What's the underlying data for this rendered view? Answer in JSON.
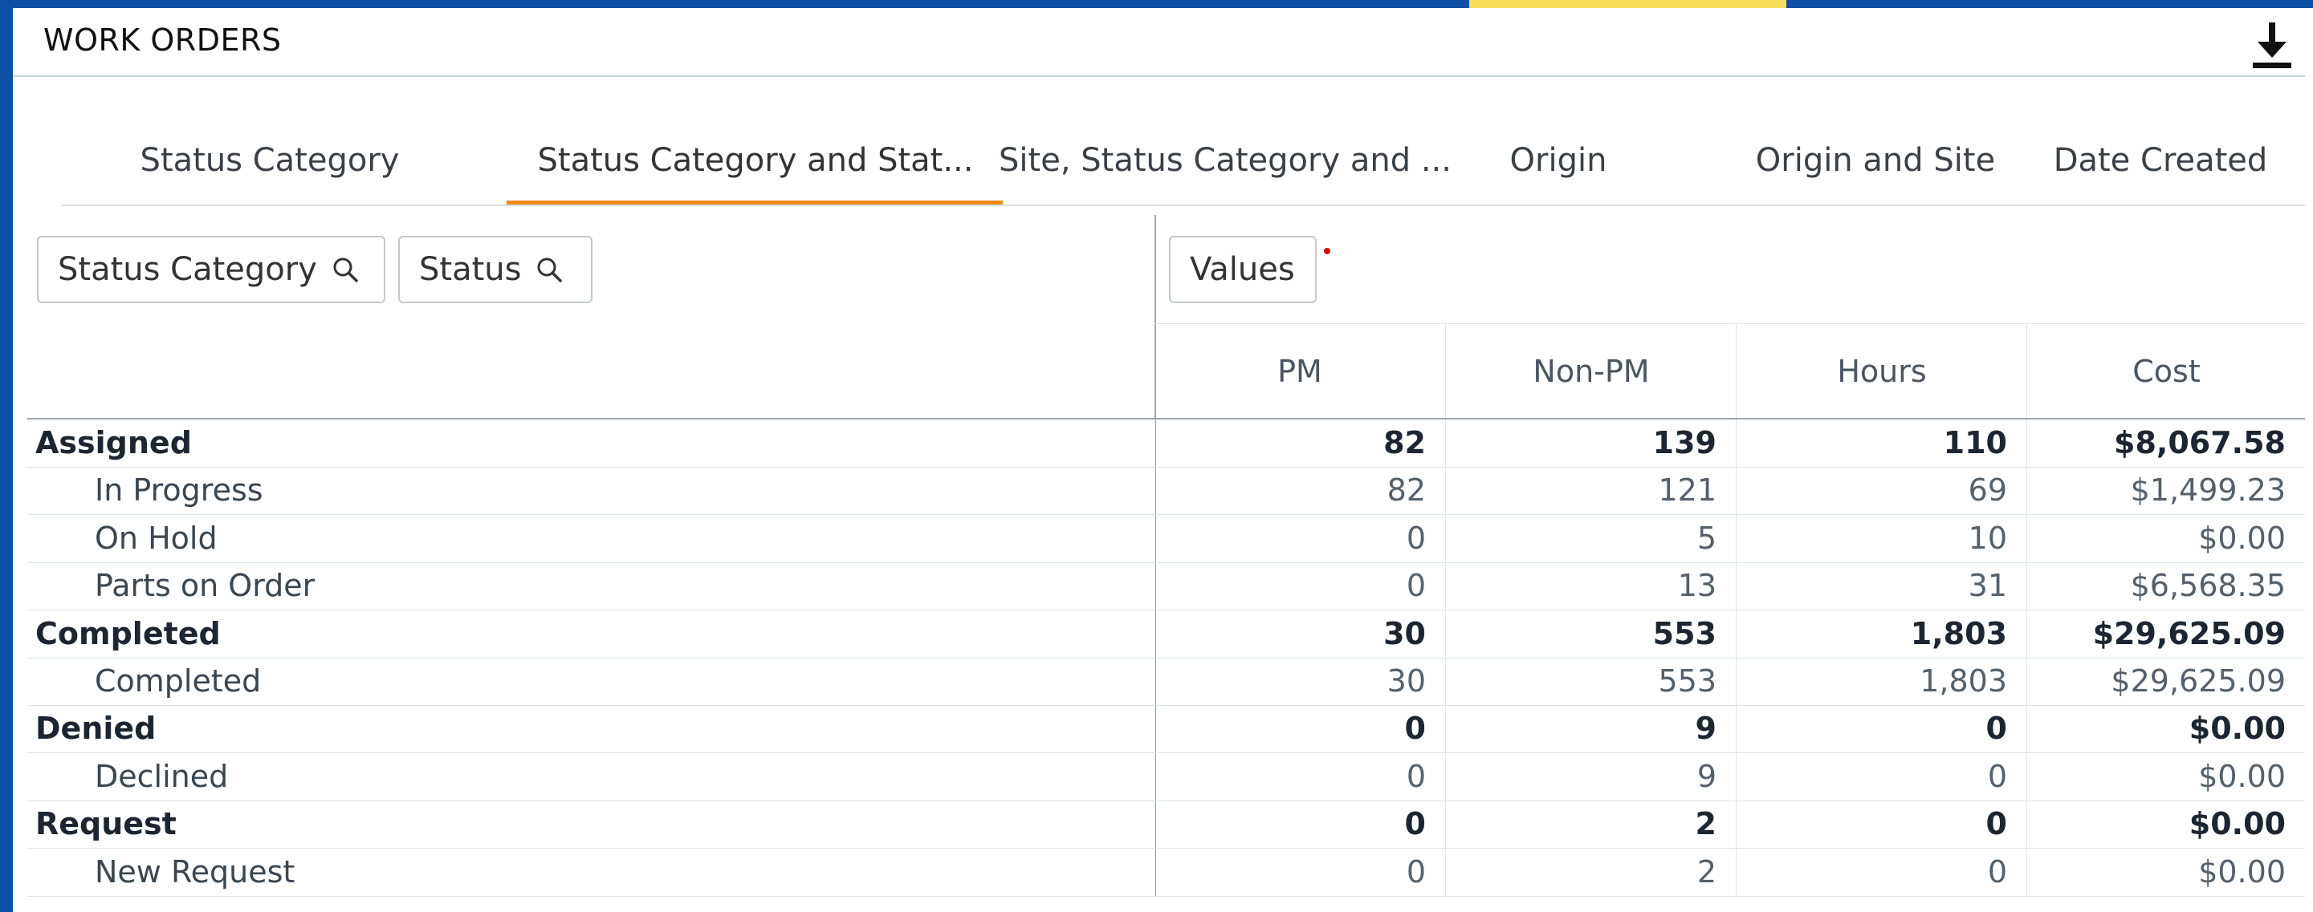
{
  "panel": {
    "title": "WORK ORDERS",
    "download_icon": "download-icon"
  },
  "tabs": [
    {
      "label": "Status Category"
    },
    {
      "label": "Status Category and Stat..."
    },
    {
      "label": "Site, Status Category and ..."
    },
    {
      "label": "Origin"
    },
    {
      "label": "Origin and Site"
    },
    {
      "label": "Date Created"
    }
  ],
  "active_tab": 1,
  "filters": {
    "status_category": "Status Category",
    "status": "Status",
    "values": "Values"
  },
  "columns": [
    "PM",
    "Non-PM",
    "Hours",
    "Cost"
  ],
  "rows": [
    {
      "label": "Assigned",
      "pm": "82",
      "nonpm": "139",
      "hours": "110",
      "cost": "$8,067.58"
    },
    {
      "label": "In Progress",
      "pm": "82",
      "nonpm": "121",
      "hours": "69",
      "cost": "$1,499.23"
    },
    {
      "label": "On Hold",
      "pm": "0",
      "nonpm": "5",
      "hours": "10",
      "cost": "$0.00"
    },
    {
      "label": "Parts on Order",
      "pm": "0",
      "nonpm": "13",
      "hours": "31",
      "cost": "$6,568.35"
    },
    {
      "label": "Completed",
      "pm": "30",
      "nonpm": "553",
      "hours": "1,803",
      "cost": "$29,625.09"
    },
    {
      "label": "Completed",
      "pm": "30",
      "nonpm": "553",
      "hours": "1,803",
      "cost": "$29,625.09"
    },
    {
      "label": "Denied",
      "pm": "0",
      "nonpm": "9",
      "hours": "0",
      "cost": "$0.00"
    },
    {
      "label": "Declined",
      "pm": "0",
      "nonpm": "9",
      "hours": "0",
      "cost": "$0.00"
    },
    {
      "label": "Request",
      "pm": "0",
      "nonpm": "2",
      "hours": "0",
      "cost": "$0.00"
    },
    {
      "label": "New Request",
      "pm": "0",
      "nonpm": "2",
      "hours": "0",
      "cost": "$0.00"
    }
  ],
  "colors": {
    "background": "#0d4fa3",
    "accent_yellow": "#f5de5a",
    "tab_underline": "#f08a1c"
  }
}
